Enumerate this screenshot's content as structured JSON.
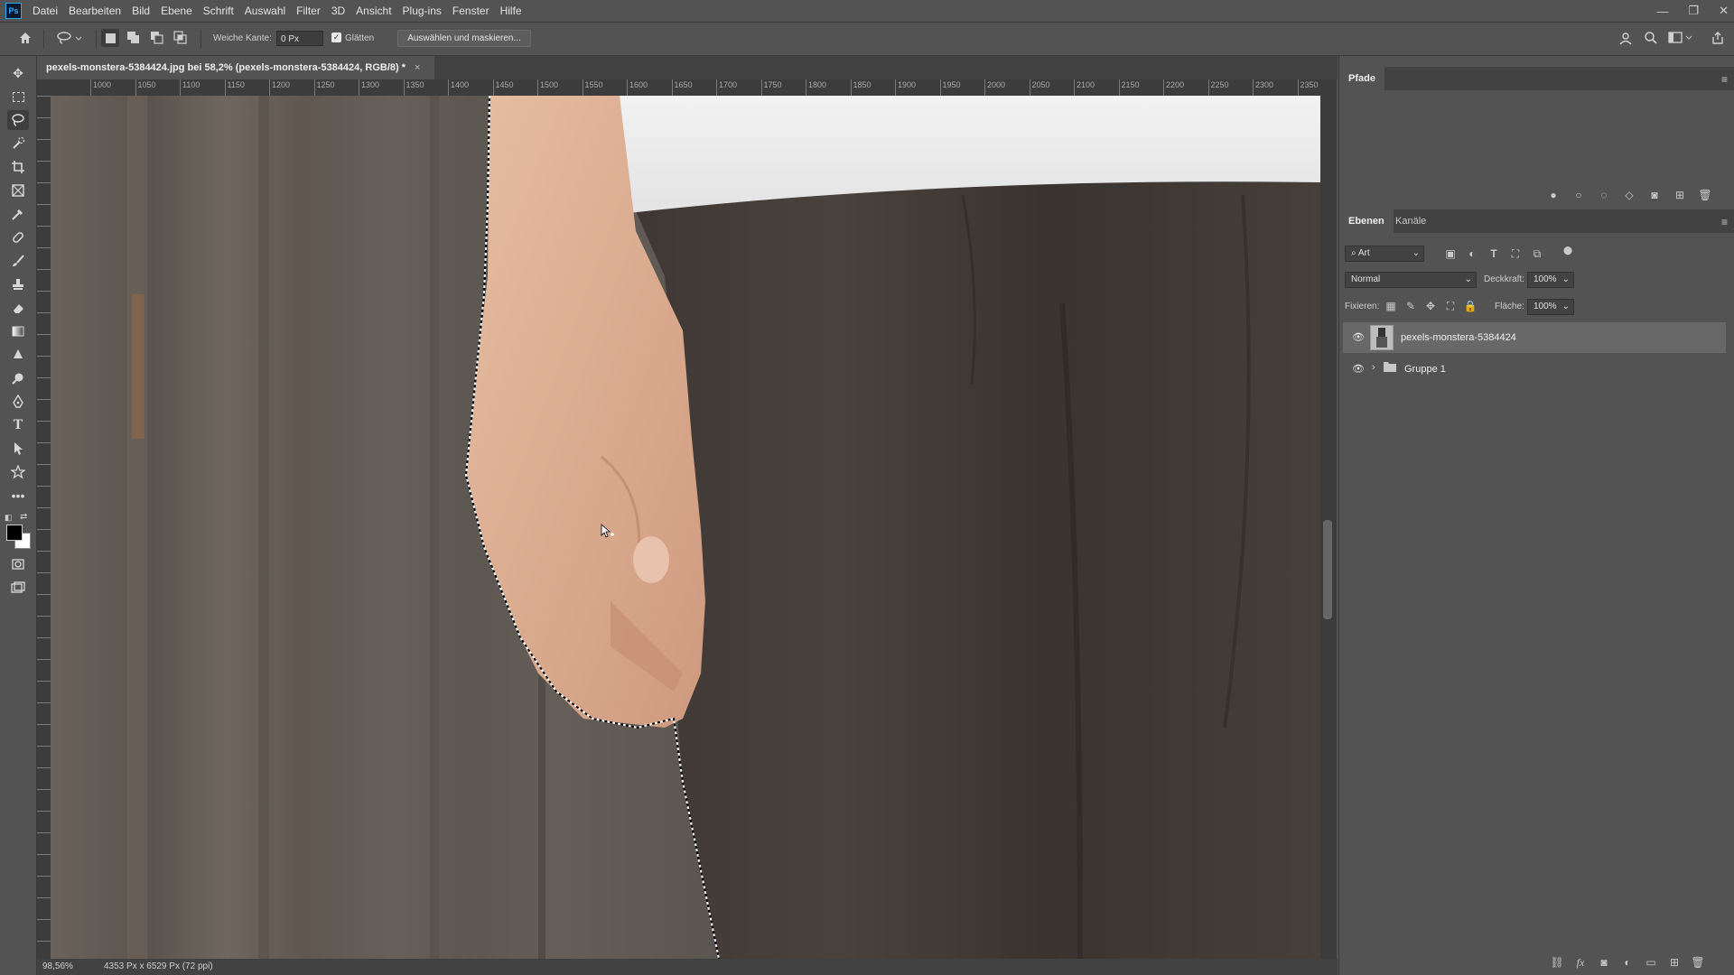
{
  "app": {
    "logo": "Ps"
  },
  "menubar": {
    "items": [
      "Datei",
      "Bearbeiten",
      "Bild",
      "Ebene",
      "Schrift",
      "Auswahl",
      "Filter",
      "3D",
      "Ansicht",
      "Plug-ins",
      "Fenster",
      "Hilfe"
    ]
  },
  "options": {
    "soft_edge_label": "Weiche Kante:",
    "soft_edge_value": "0 Px",
    "antialias_label": "Glätten",
    "antialias_checked": true,
    "select_mask_button": "Auswählen und maskieren..."
  },
  "document": {
    "tab_title": "pexels-monstera-5384424.jpg bei 58,2% (pexels-monstera-5384424, RGB/8) *",
    "close_glyph": "×"
  },
  "ruler": {
    "h_ticks": [
      "1000",
      "1050",
      "1100",
      "1150",
      "1200",
      "1250",
      "1300",
      "1350",
      "1400",
      "1450",
      "1500",
      "1550",
      "1600",
      "1650",
      "1700",
      "1750",
      "1800",
      "1850",
      "1900",
      "1950",
      "2000",
      "2050",
      "2100",
      "2150",
      "2200",
      "2250",
      "2300",
      "2350"
    ]
  },
  "status": {
    "zoom": "98,56%",
    "doc_size": "4353 Px x 6529 Px (72 ppi)"
  },
  "panels": {
    "paths": {
      "tab": "Pfade"
    },
    "layers": {
      "tabs": [
        "Ebenen",
        "Kanäle"
      ],
      "filter_kind": "Art",
      "blend_mode": "Normal",
      "opacity_label": "Deckkraft:",
      "opacity_value": "100%",
      "lock_label": "Fixieren:",
      "fill_label": "Fläche:",
      "fill_value": "100%",
      "items": [
        {
          "name": "pexels-monstera-5384424",
          "type": "image",
          "visible": true,
          "selected": true
        },
        {
          "name": "Gruppe 1",
          "type": "group",
          "visible": true,
          "selected": false
        }
      ]
    }
  },
  "colors": {
    "ui_bg": "#535353",
    "ui_dark": "#424242",
    "ps_blue": "#31a8ff",
    "foreground_swatch": "#000000",
    "background_swatch": "#ffffff"
  }
}
